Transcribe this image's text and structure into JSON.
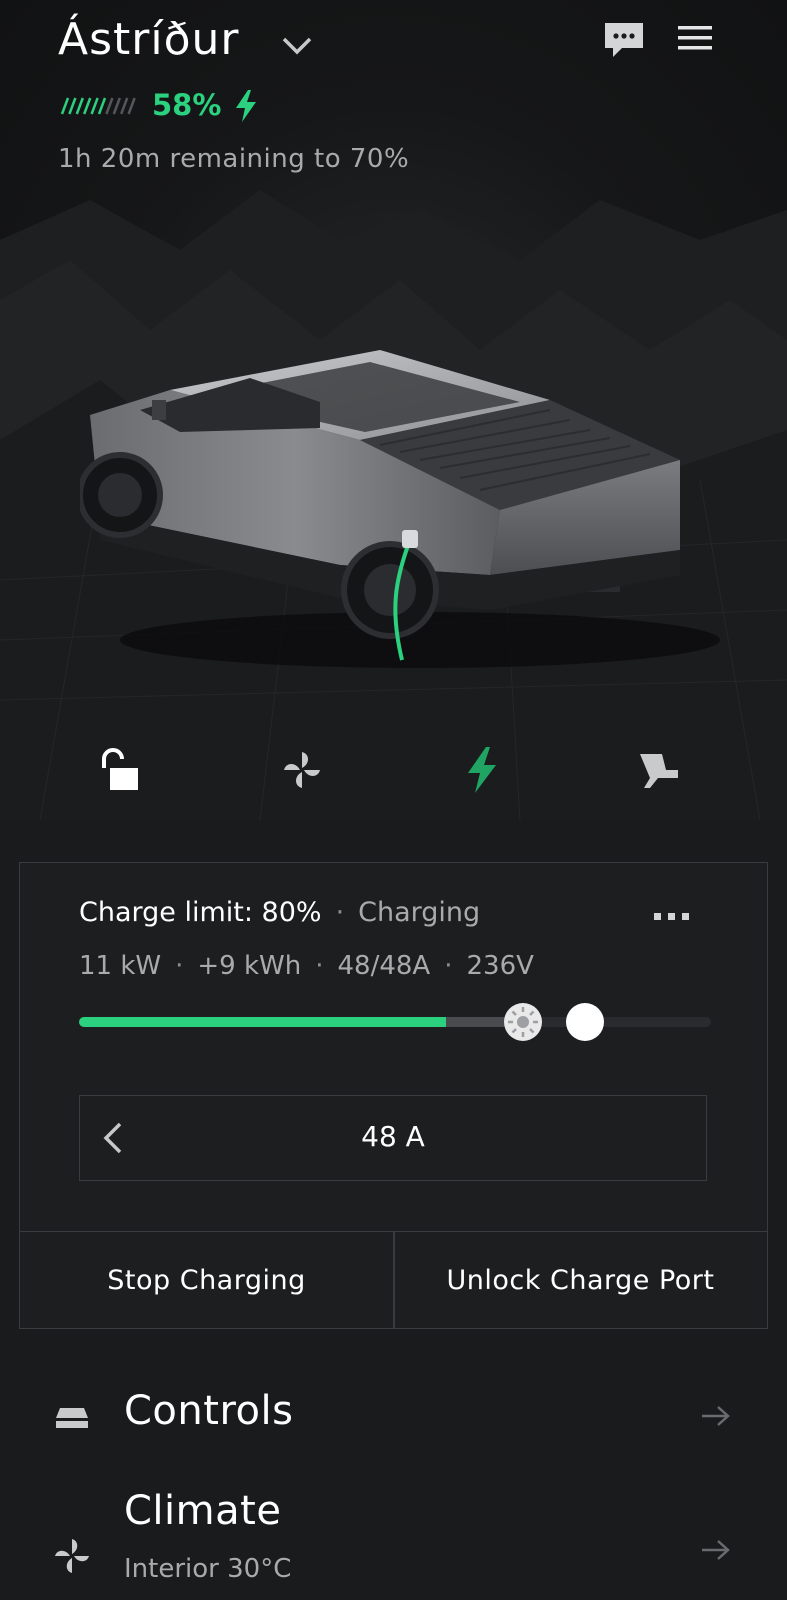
{
  "header": {
    "vehicle_name": "Ástríður",
    "battery_percent": "58%",
    "battery_level": 0.58,
    "remaining": "1h 20m remaining to 70%"
  },
  "quick_actions": [
    {
      "name": "lock",
      "icon": "unlock-icon"
    },
    {
      "name": "climate",
      "icon": "fan-icon"
    },
    {
      "name": "charge",
      "icon": "bolt-icon"
    },
    {
      "name": "seat",
      "icon": "seat-icon"
    }
  ],
  "charge": {
    "limit_label": "Charge limit: 80%",
    "status": "Charging",
    "stats": [
      "11 kW",
      "+9 kWh",
      "48/48A",
      "236V"
    ],
    "current_level": 0.58,
    "scheduled_level": 0.7,
    "limit_level": 0.8,
    "amperage": "48 A",
    "stop_label": "Stop Charging",
    "unlock_label": "Unlock Charge Port"
  },
  "nav": {
    "controls": {
      "label": "Controls",
      "icon": "car-icon"
    },
    "climate": {
      "label": "Climate",
      "sub": "Interior 30°C",
      "icon": "fan-icon"
    }
  },
  "colors": {
    "accent": "#2bd17e",
    "background": "#1a1b1d",
    "muted_text": "#a9aaac"
  }
}
